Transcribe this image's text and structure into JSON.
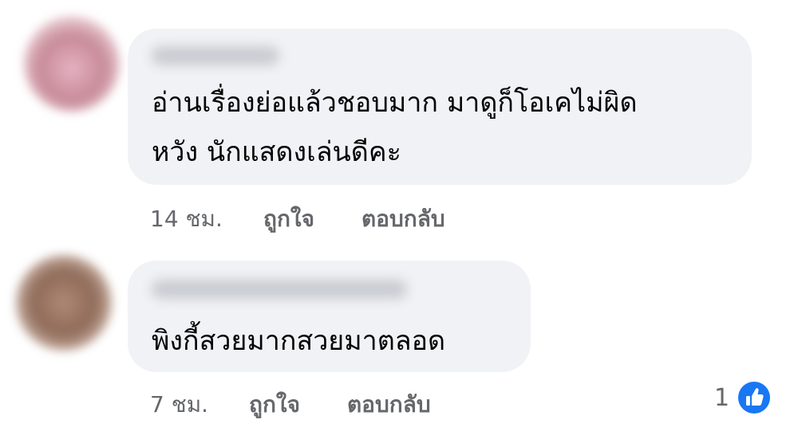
{
  "comments": [
    {
      "text_lines": [
        "อ่านเรื่องย่อแล้วชอบมาก มาดูก็โอเคไม่ผิด",
        "หวัง นักแสดงเล่นดีคะ"
      ],
      "time": "14 ชม.",
      "like_label": "ถูกใจ",
      "reply_label": "ตอบกลับ"
    },
    {
      "text_lines": [
        "พิงกี้สวยมากสวยมาตลอด"
      ],
      "time": "7 ชม.",
      "like_label": "ถูกใจ",
      "reply_label": "ตอบกลับ",
      "reaction_count": "1",
      "reaction_icon": "like-thumbs-up-icon"
    }
  ],
  "colors": {
    "bubble": "#f0f2f5",
    "text": "#050505",
    "meta": "#65676b",
    "like_blue": "#1877f2"
  }
}
